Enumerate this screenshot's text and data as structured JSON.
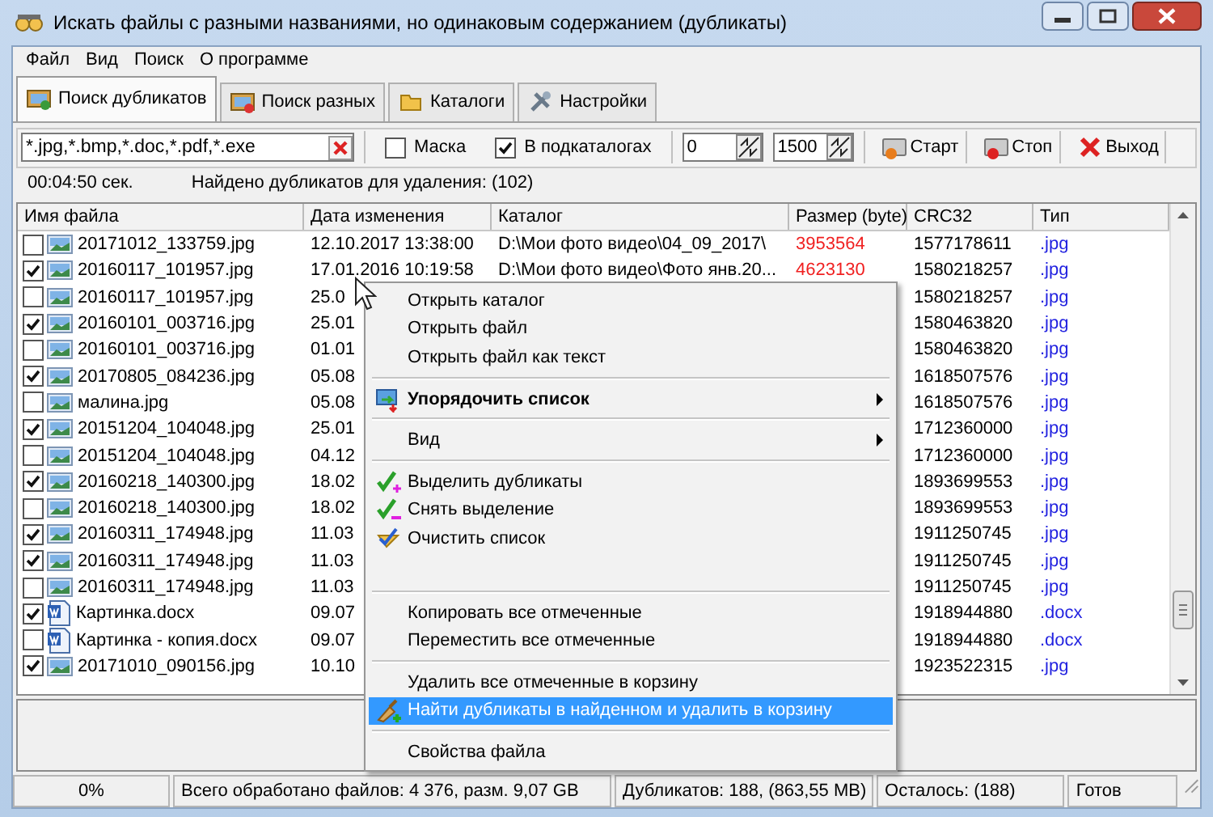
{
  "window": {
    "title": "Искать файлы с разными названиями, но одинаковым содержанием (дубликаты)"
  },
  "menu_bar": [
    "Файл",
    "Вид",
    "Поиск",
    "О программе"
  ],
  "tabs": [
    {
      "label": "Поиск дубликатов",
      "selected": true
    },
    {
      "label": "Поиск разных",
      "selected": false
    },
    {
      "label": "Каталоги",
      "selected": false
    },
    {
      "label": "Настройки",
      "selected": false
    }
  ],
  "toolbar": {
    "mask_field": {
      "value": "*.jpg,*.bmp,*.doc,*.pdf,*.exe"
    },
    "checkboxes": [
      {
        "label": "Маска",
        "checked": false
      },
      {
        "label": "В подкаталогах",
        "checked": true
      }
    ],
    "spin_fields": [
      {
        "value": "0"
      },
      {
        "value": "1500"
      }
    ],
    "buttons": [
      "Старт",
      "Стоп",
      "Выход"
    ]
  },
  "info": {
    "elapsed": "00:04:50 сек.",
    "found": "Найдено дубликатов для удаления: (102)"
  },
  "table": {
    "columns": [
      "Имя файла",
      "Дата изменения",
      "Каталог",
      "Размер (byte)",
      "CRC32",
      "Тип"
    ],
    "rows": [
      {
        "kind": "image",
        "checked": false,
        "name": "20171012_133759.jpg",
        "date": "12.10.2017 13:38:00",
        "catalog": "D:\\Мои фото видео\\04_09_2017\\",
        "size": "3953564",
        "crc": "1577178611",
        "type": ".jpg"
      },
      {
        "kind": "image",
        "checked": true,
        "name": "20160117_101957.jpg",
        "date": "17.01.2016 10:19:58",
        "catalog": "D:\\Мои фото видео\\Фото янв.20...",
        "size": "4623130",
        "crc": "1580218257",
        "type": ".jpg"
      },
      {
        "kind": "image",
        "checked": false,
        "name": "20160117_101957.jpg",
        "date": "25.0",
        "crc": "1580218257",
        "type": ".jpg"
      },
      {
        "kind": "image",
        "checked": true,
        "name": "20160101_003716.jpg",
        "date": "25.01",
        "crc": "1580463820",
        "type": ".jpg"
      },
      {
        "kind": "image",
        "checked": false,
        "name": "20160101_003716.jpg",
        "date": "01.01",
        "crc": "1580463820",
        "type": ".jpg"
      },
      {
        "kind": "image",
        "checked": true,
        "name": "20170805_084236.jpg",
        "date": "05.08",
        "crc": "1618507576",
        "type": ".jpg"
      },
      {
        "kind": "image",
        "checked": false,
        "name": "малина.jpg",
        "date": "05.08",
        "crc": "1618507576",
        "type": ".jpg"
      },
      {
        "kind": "image",
        "checked": true,
        "name": "20151204_104048.jpg",
        "date": "25.01",
        "crc": "1712360000",
        "type": ".jpg"
      },
      {
        "kind": "image",
        "checked": false,
        "name": "20151204_104048.jpg",
        "date": "04.12",
        "crc": "1712360000",
        "type": ".jpg"
      },
      {
        "kind": "image",
        "checked": true,
        "name": "20160218_140300.jpg",
        "date": "18.02",
        "crc": "1893699553",
        "type": ".jpg"
      },
      {
        "kind": "image",
        "checked": false,
        "name": "20160218_140300.jpg",
        "date": "18.02",
        "crc": "1893699553",
        "type": ".jpg"
      },
      {
        "kind": "image",
        "checked": true,
        "name": "20160311_174948.jpg",
        "date": "11.03",
        "crc": "1911250745",
        "type": ".jpg"
      },
      {
        "kind": "image",
        "checked": true,
        "name": "20160311_174948.jpg",
        "date": "11.03",
        "crc": "1911250745",
        "type": ".jpg"
      },
      {
        "kind": "image",
        "checked": false,
        "name": "20160311_174948.jpg",
        "date": "11.03",
        "crc": "1911250745",
        "type": ".jpg"
      },
      {
        "kind": "document",
        "checked": true,
        "name": "Картинка.docx",
        "date": "09.07",
        "crc": "1918944880",
        "type": ".docx"
      },
      {
        "kind": "document",
        "checked": false,
        "name": "Картинка - копия.docx",
        "date": "09.07",
        "crc": "1918944880",
        "type": ".docx"
      },
      {
        "kind": "image",
        "checked": true,
        "name": "20171010_090156.jpg",
        "date": "10.10",
        "crc": "1923522315",
        "type": ".jpg"
      }
    ]
  },
  "context_menu": {
    "items": [
      {
        "kind": "command",
        "label": "Открыть каталог",
        "default": false,
        "selected": false
      },
      {
        "kind": "command",
        "label": "Открыть файл",
        "default": false,
        "selected": false
      },
      {
        "kind": "command",
        "label": "Открыть файл как текст",
        "default": false,
        "selected": false
      },
      {
        "kind": "separator"
      },
      {
        "kind": "submenu",
        "label": "Упорядочить список",
        "default": true,
        "selected": false
      },
      {
        "kind": "separator"
      },
      {
        "kind": "submenu",
        "label": "Вид",
        "default": false,
        "selected": false
      },
      {
        "kind": "separator"
      },
      {
        "kind": "command",
        "label": "Выделить дубликаты",
        "default": false,
        "selected": false
      },
      {
        "kind": "command",
        "label": "Снять выделение",
        "default": false,
        "selected": false
      },
      {
        "kind": "command",
        "label": "Очистить список",
        "default": false,
        "selected": false
      },
      {
        "kind": "spacer"
      },
      {
        "kind": "separator"
      },
      {
        "kind": "command",
        "label": "Копировать все отмеченные",
        "default": false,
        "selected": false
      },
      {
        "kind": "command",
        "label": "Переместить все отмеченные",
        "default": false,
        "selected": false
      },
      {
        "kind": "separator"
      },
      {
        "kind": "command",
        "label": "Удалить все отмеченные в корзину",
        "default": false,
        "selected": false
      },
      {
        "kind": "command",
        "label": "Найти дубликаты в найденном и удалить в корзину",
        "default": false,
        "selected": true
      },
      {
        "kind": "separator"
      },
      {
        "kind": "command",
        "label": "Свойства файла",
        "default": false,
        "selected": false
      }
    ]
  },
  "status_bar": [
    "0%",
    "Всего обработано файлов: 4 376, разм. 9,07 GB",
    "Дубликатов: 188,  (863,55 MB)",
    "Осталось: (188)",
    "Готов"
  ]
}
